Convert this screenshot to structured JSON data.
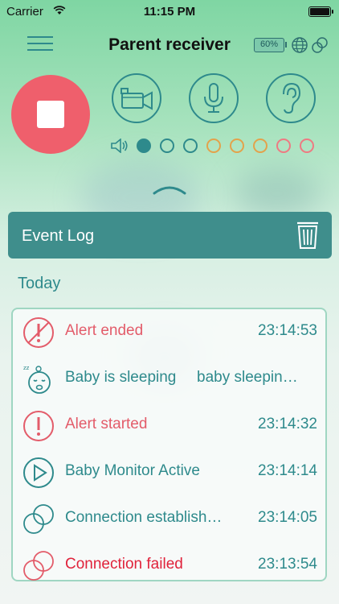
{
  "status_bar": {
    "carrier": "Carrier",
    "time": "11:15 PM"
  },
  "header": {
    "title": "Parent receiver",
    "battery_level": "60%"
  },
  "controls": {
    "stop_icon": "stop-icon",
    "camera_icon": "video-camera-icon",
    "mic_icon": "microphone-icon",
    "ear_icon": "ear-icon"
  },
  "volume": {
    "icon": "speaker-icon",
    "level": 1,
    "max": 8
  },
  "event_log": {
    "title": "Event Log",
    "section": "Today",
    "events": [
      {
        "label": "Alert ended",
        "time": "23:14:53",
        "icon": "alert-ended-icon"
      },
      {
        "label": "Baby is sleeping",
        "time": "baby sleepin…",
        "icon": "sleeping-baby-icon"
      },
      {
        "label": "Alert started",
        "time": "23:14:32",
        "icon": "alert-icon"
      },
      {
        "label": "Baby Monitor Active",
        "time": "23:14:14",
        "icon": "play-icon"
      },
      {
        "label": "Connection establish…",
        "time": "23:14:05",
        "icon": "connection-icon"
      },
      {
        "label": "Connection failed",
        "time": "23:13:54",
        "icon": "connection-failed-icon"
      }
    ]
  },
  "colors": {
    "teal": "#2e8a8c",
    "alert_red": "#e35c6a",
    "stop_red": "#ef5f6c",
    "orange": "#e3a24b"
  }
}
